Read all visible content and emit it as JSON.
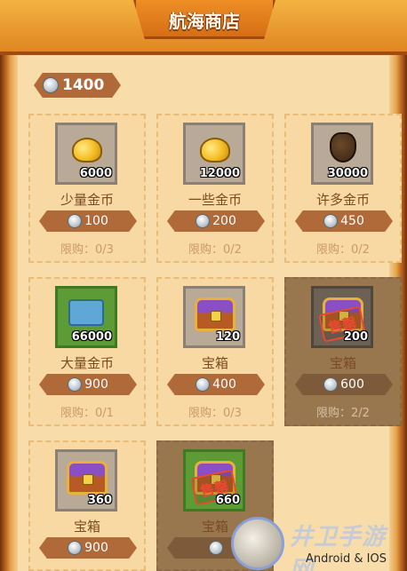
{
  "header": {
    "title": "航海商店"
  },
  "currency": {
    "amount": "1400",
    "icon": "silver-coin-icon"
  },
  "items": [
    {
      "name": "少量金币",
      "qty": "6000",
      "price": "100",
      "limit": "限购：0/3",
      "icon": "gold-coins-icon",
      "sold_out": false
    },
    {
      "name": "一些金币",
      "qty": "12000",
      "price": "200",
      "limit": "限购：0/2",
      "icon": "gold-coins-icon",
      "sold_out": false
    },
    {
      "name": "许多金币",
      "qty": "30000",
      "price": "450",
      "limit": "限购：0/2",
      "icon": "gold-bag-icon",
      "sold_out": false
    },
    {
      "name": "大量金币",
      "qty": "66000",
      "price": "900",
      "limit": "限购：0/1",
      "icon": "gold-pile-icon",
      "sold_out": false
    },
    {
      "name": "宝箱",
      "qty": "120",
      "price": "400",
      "limit": "限购：0/3",
      "icon": "chest-icon",
      "sold_out": false
    },
    {
      "name": "宝箱",
      "qty": "200",
      "price": "600",
      "limit": "限购：2/2",
      "icon": "chest-icon",
      "sold_out": true,
      "stamp": "售罄"
    },
    {
      "name": "宝箱",
      "qty": "360",
      "price": "900",
      "limit": "",
      "icon": "chest-icon",
      "sold_out": false
    },
    {
      "name": "宝箱",
      "qty": "660",
      "price": "",
      "limit": "",
      "icon": "chest-icon",
      "sold_out": true,
      "stamp": "售罄"
    }
  ],
  "watermark": {
    "text": "井卫手游网",
    "sub": "Android & IOS"
  }
}
